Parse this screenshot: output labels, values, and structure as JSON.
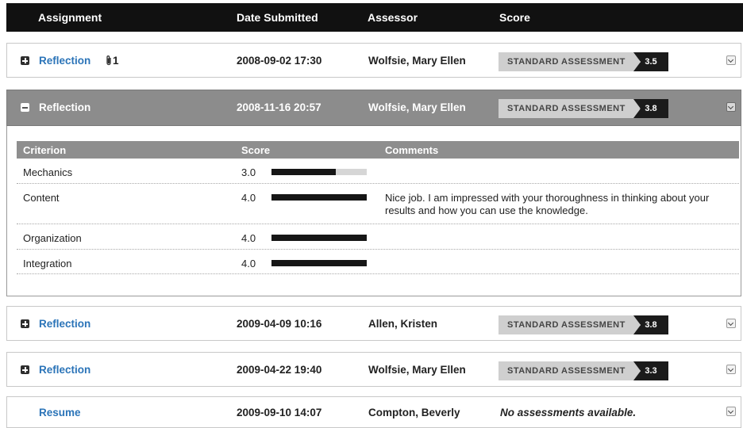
{
  "header": {
    "assignment": "Assignment",
    "date_submitted": "Date Submitted",
    "assessor": "Assessor",
    "score": "Score"
  },
  "rows": [
    {
      "assignment": "Reflection",
      "attachment_count": "1",
      "date": "2008-09-02 17:30",
      "assessor": "Wolfsie, Mary Ellen",
      "assessment_label": "STANDARD ASSESSMENT",
      "score": "3.5"
    },
    {
      "assignment": "Reflection",
      "date": "2008-11-16 20:57",
      "assessor": "Wolfsie, Mary Ellen",
      "assessment_label": "STANDARD ASSESSMENT",
      "score": "3.8",
      "expanded": true
    },
    {
      "assignment": "Reflection",
      "date": "2009-04-09 10:16",
      "assessor": "Allen, Kristen",
      "assessment_label": "STANDARD ASSESSMENT",
      "score": "3.8"
    },
    {
      "assignment": "Reflection",
      "date": "2009-04-22 19:40",
      "assessor": "Wolfsie, Mary Ellen",
      "assessment_label": "STANDARD ASSESSMENT",
      "score": "3.3"
    },
    {
      "assignment": "Resume",
      "date": "2009-09-10 14:07",
      "assessor": "Compton, Beverly",
      "no_assessment": "No assessments available."
    }
  ],
  "detail": {
    "headers": {
      "criterion": "Criterion",
      "score": "Score",
      "comments": "Comments"
    },
    "criteria": [
      {
        "name": "Mechanics",
        "score": "3.0",
        "fraction": 0.675,
        "comment": ""
      },
      {
        "name": "Content",
        "score": "4.0",
        "fraction": 1.0,
        "comment": "Nice job. I am impressed with your thoroughness in thinking about your results and how you can use the knowledge."
      },
      {
        "name": "Organization",
        "score": "4.0",
        "fraction": 1.0,
        "comment": ""
      },
      {
        "name": "Integration",
        "score": "4.0",
        "fraction": 1.0,
        "comment": ""
      }
    ]
  },
  "colors": {
    "header_bg": "#111111",
    "link": "#2b74b8",
    "expanded_bg": "#8c8c8c",
    "score_pill": "#1b1b1b",
    "assessment_pill": "#cfcfcf"
  },
  "icons": {
    "expand": "plus-square-icon",
    "collapse": "minus-square-icon",
    "attachment": "paperclip-icon",
    "menu": "chevron-down-icon"
  }
}
